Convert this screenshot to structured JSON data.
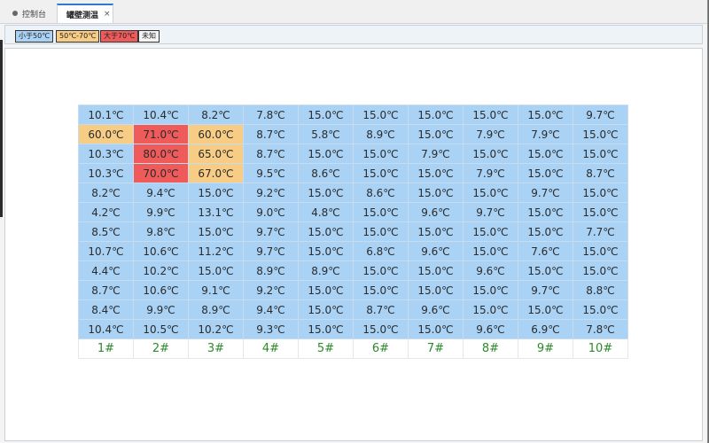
{
  "tabs": [
    {
      "label": "控制台",
      "active": false
    },
    {
      "label": "罐壁测温",
      "active": true,
      "close": "×"
    }
  ],
  "legend": {
    "low": "小于50℃",
    "mid": "50℃-70℃",
    "high": "大于70℃",
    "unknown": "未知"
  },
  "colors": {
    "low": "#a9d2f5",
    "mid": "#f7cd86",
    "high": "#ef5a5a",
    "label": "#2a8a2a"
  },
  "grid": {
    "columns": [
      "1#",
      "2#",
      "3#",
      "4#",
      "5#",
      "6#",
      "7#",
      "8#",
      "9#",
      "10#"
    ],
    "rows": [
      [
        {
          "t": "10.1℃",
          "c": "low"
        },
        {
          "t": "10.4℃",
          "c": "low"
        },
        {
          "t": "8.2℃",
          "c": "low"
        },
        {
          "t": "7.8℃",
          "c": "low"
        },
        {
          "t": "15.0℃",
          "c": "low"
        },
        {
          "t": "15.0℃",
          "c": "low"
        },
        {
          "t": "15.0℃",
          "c": "low"
        },
        {
          "t": "15.0℃",
          "c": "low"
        },
        {
          "t": "15.0℃",
          "c": "low"
        },
        {
          "t": "9.7℃",
          "c": "low"
        }
      ],
      [
        {
          "t": "60.0℃",
          "c": "mid"
        },
        {
          "t": "71.0℃",
          "c": "high"
        },
        {
          "t": "60.0℃",
          "c": "mid"
        },
        {
          "t": "8.7℃",
          "c": "low"
        },
        {
          "t": "5.8℃",
          "c": "low"
        },
        {
          "t": "8.9℃",
          "c": "low"
        },
        {
          "t": "15.0℃",
          "c": "low"
        },
        {
          "t": "7.9℃",
          "c": "low"
        },
        {
          "t": "7.9℃",
          "c": "low"
        },
        {
          "t": "15.0℃",
          "c": "low"
        }
      ],
      [
        {
          "t": "10.3℃",
          "c": "low"
        },
        {
          "t": "80.0℃",
          "c": "high"
        },
        {
          "t": "65.0℃",
          "c": "mid"
        },
        {
          "t": "8.7℃",
          "c": "low"
        },
        {
          "t": "15.0℃",
          "c": "low"
        },
        {
          "t": "15.0℃",
          "c": "low"
        },
        {
          "t": "7.9℃",
          "c": "low"
        },
        {
          "t": "15.0℃",
          "c": "low"
        },
        {
          "t": "15.0℃",
          "c": "low"
        },
        {
          "t": "15.0℃",
          "c": "low"
        }
      ],
      [
        {
          "t": "10.3℃",
          "c": "low"
        },
        {
          "t": "70.0℃",
          "c": "high"
        },
        {
          "t": "67.0℃",
          "c": "mid"
        },
        {
          "t": "9.5℃",
          "c": "low"
        },
        {
          "t": "8.6℃",
          "c": "low"
        },
        {
          "t": "15.0℃",
          "c": "low"
        },
        {
          "t": "15.0℃",
          "c": "low"
        },
        {
          "t": "7.9℃",
          "c": "low"
        },
        {
          "t": "15.0℃",
          "c": "low"
        },
        {
          "t": "8.7℃",
          "c": "low"
        }
      ],
      [
        {
          "t": "8.2℃",
          "c": "low"
        },
        {
          "t": "9.4℃",
          "c": "low"
        },
        {
          "t": "15.0℃",
          "c": "low"
        },
        {
          "t": "9.2℃",
          "c": "low"
        },
        {
          "t": "15.0℃",
          "c": "low"
        },
        {
          "t": "8.6℃",
          "c": "low"
        },
        {
          "t": "15.0℃",
          "c": "low"
        },
        {
          "t": "15.0℃",
          "c": "low"
        },
        {
          "t": "9.7℃",
          "c": "low"
        },
        {
          "t": "15.0℃",
          "c": "low"
        }
      ],
      [
        {
          "t": "4.2℃",
          "c": "low"
        },
        {
          "t": "9.9℃",
          "c": "low"
        },
        {
          "t": "13.1℃",
          "c": "low"
        },
        {
          "t": "9.0℃",
          "c": "low"
        },
        {
          "t": "4.8℃",
          "c": "low"
        },
        {
          "t": "15.0℃",
          "c": "low"
        },
        {
          "t": "9.6℃",
          "c": "low"
        },
        {
          "t": "9.7℃",
          "c": "low"
        },
        {
          "t": "15.0℃",
          "c": "low"
        },
        {
          "t": "15.0℃",
          "c": "low"
        }
      ],
      [
        {
          "t": "8.5℃",
          "c": "low"
        },
        {
          "t": "9.8℃",
          "c": "low"
        },
        {
          "t": "15.0℃",
          "c": "low"
        },
        {
          "t": "9.7℃",
          "c": "low"
        },
        {
          "t": "15.0℃",
          "c": "low"
        },
        {
          "t": "15.0℃",
          "c": "low"
        },
        {
          "t": "15.0℃",
          "c": "low"
        },
        {
          "t": "15.0℃",
          "c": "low"
        },
        {
          "t": "15.0℃",
          "c": "low"
        },
        {
          "t": "7.7℃",
          "c": "low"
        }
      ],
      [
        {
          "t": "10.7℃",
          "c": "low"
        },
        {
          "t": "10.6℃",
          "c": "low"
        },
        {
          "t": "11.2℃",
          "c": "low"
        },
        {
          "t": "9.7℃",
          "c": "low"
        },
        {
          "t": "15.0℃",
          "c": "low"
        },
        {
          "t": "6.8℃",
          "c": "low"
        },
        {
          "t": "9.6℃",
          "c": "low"
        },
        {
          "t": "15.0℃",
          "c": "low"
        },
        {
          "t": "7.6℃",
          "c": "low"
        },
        {
          "t": "15.0℃",
          "c": "low"
        }
      ],
      [
        {
          "t": "4.4℃",
          "c": "low"
        },
        {
          "t": "10.2℃",
          "c": "low"
        },
        {
          "t": "15.0℃",
          "c": "low"
        },
        {
          "t": "8.9℃",
          "c": "low"
        },
        {
          "t": "8.9℃",
          "c": "low"
        },
        {
          "t": "15.0℃",
          "c": "low"
        },
        {
          "t": "15.0℃",
          "c": "low"
        },
        {
          "t": "9.6℃",
          "c": "low"
        },
        {
          "t": "15.0℃",
          "c": "low"
        },
        {
          "t": "15.0℃",
          "c": "low"
        }
      ],
      [
        {
          "t": "8.7℃",
          "c": "low"
        },
        {
          "t": "10.6℃",
          "c": "low"
        },
        {
          "t": "9.1℃",
          "c": "low"
        },
        {
          "t": "9.2℃",
          "c": "low"
        },
        {
          "t": "15.0℃",
          "c": "low"
        },
        {
          "t": "15.0℃",
          "c": "low"
        },
        {
          "t": "15.0℃",
          "c": "low"
        },
        {
          "t": "15.0℃",
          "c": "low"
        },
        {
          "t": "9.7℃",
          "c": "low"
        },
        {
          "t": "8.8℃",
          "c": "low"
        }
      ],
      [
        {
          "t": "8.4℃",
          "c": "low"
        },
        {
          "t": "9.9℃",
          "c": "low"
        },
        {
          "t": "8.9℃",
          "c": "low"
        },
        {
          "t": "9.4℃",
          "c": "low"
        },
        {
          "t": "15.0℃",
          "c": "low"
        },
        {
          "t": "8.7℃",
          "c": "low"
        },
        {
          "t": "9.6℃",
          "c": "low"
        },
        {
          "t": "15.0℃",
          "c": "low"
        },
        {
          "t": "15.0℃",
          "c": "low"
        },
        {
          "t": "15.0℃",
          "c": "low"
        }
      ],
      [
        {
          "t": "10.4℃",
          "c": "low"
        },
        {
          "t": "10.5℃",
          "c": "low"
        },
        {
          "t": "10.2℃",
          "c": "low"
        },
        {
          "t": "9.3℃",
          "c": "low"
        },
        {
          "t": "15.0℃",
          "c": "low"
        },
        {
          "t": "15.0℃",
          "c": "low"
        },
        {
          "t": "15.0℃",
          "c": "low"
        },
        {
          "t": "9.6℃",
          "c": "low"
        },
        {
          "t": "6.9℃",
          "c": "low"
        },
        {
          "t": "7.8℃",
          "c": "low"
        }
      ]
    ]
  }
}
